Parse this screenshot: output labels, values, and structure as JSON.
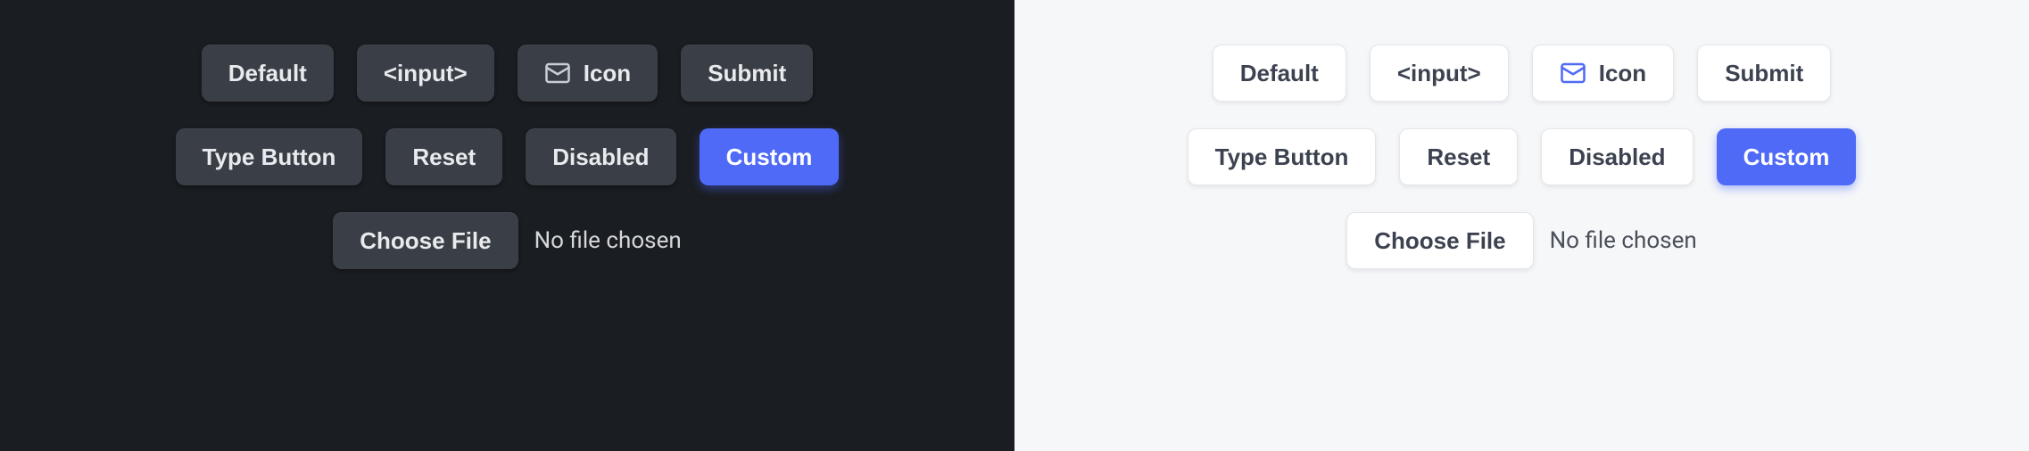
{
  "buttons": {
    "default": "Default",
    "input": "<input>",
    "icon": "Icon",
    "submit": "Submit",
    "type_button": "Type Button",
    "reset": "Reset",
    "disabled": "Disabled",
    "custom": "Custom",
    "choose_file": "Choose File"
  },
  "file_status": "No file chosen",
  "icon_name": "mail-icon",
  "colors": {
    "dark_bg": "#1a1d21",
    "light_bg": "#f6f7f9",
    "dark_btn": "#3a3f47",
    "light_btn": "#ffffff",
    "accent": "#4f6af6"
  }
}
